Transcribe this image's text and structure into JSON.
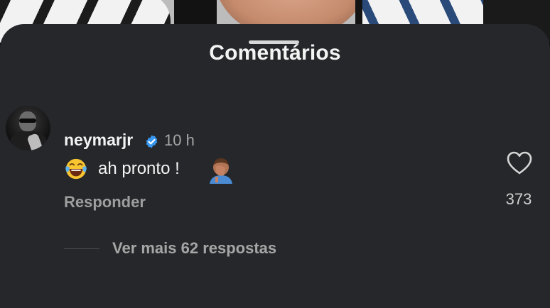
{
  "sheet": {
    "title": "Comentários"
  },
  "comment": {
    "username": "neymarjr",
    "verified": true,
    "time": "10 h",
    "text": "ah pronto !",
    "leading_emoji": "face-with-tears-of-joy",
    "trailing_emoji": "man-facepalming",
    "reply_label": "Responder",
    "like_count": "373",
    "view_more_label": "Ver mais 62 respostas"
  },
  "colors": {
    "sheet_background": "#25272a",
    "primary_text": "#f4f4f4",
    "secondary_text": "#a6a6a6",
    "verified_blue": "#3897f0"
  }
}
